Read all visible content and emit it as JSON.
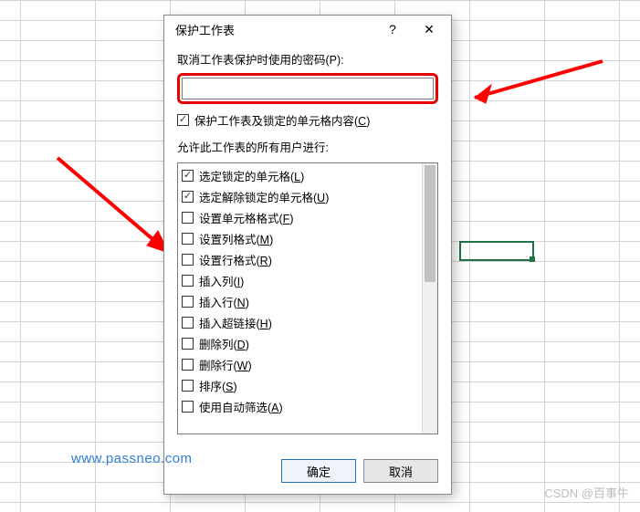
{
  "dialog": {
    "title": "保护工作表",
    "help_label": "?",
    "close_label": "✕",
    "password_label": "取消工作表保护时使用的密码(P):",
    "password_value": "",
    "protect_checkbox": {
      "checked": true,
      "label": "保护工作表及锁定的单元格内容(C)"
    },
    "permissions_label": "允许此工作表的所有用户进行:",
    "permissions": [
      {
        "checked": true,
        "label": "选定锁定的单元格(L)"
      },
      {
        "checked": true,
        "label": "选定解除锁定的单元格(U)"
      },
      {
        "checked": false,
        "label": "设置单元格格式(F)"
      },
      {
        "checked": false,
        "label": "设置列格式(M)"
      },
      {
        "checked": false,
        "label": "设置行格式(R)"
      },
      {
        "checked": false,
        "label": "插入列(I)"
      },
      {
        "checked": false,
        "label": "插入行(N)"
      },
      {
        "checked": false,
        "label": "插入超链接(H)"
      },
      {
        "checked": false,
        "label": "删除列(D)"
      },
      {
        "checked": false,
        "label": "删除行(W)"
      },
      {
        "checked": false,
        "label": "排序(S)"
      },
      {
        "checked": false,
        "label": "使用自动筛选(A)"
      }
    ],
    "ok_label": "确定",
    "cancel_label": "取消"
  },
  "watermark1": "www.passneo.com",
  "watermark2": "CSDN @百事牛"
}
